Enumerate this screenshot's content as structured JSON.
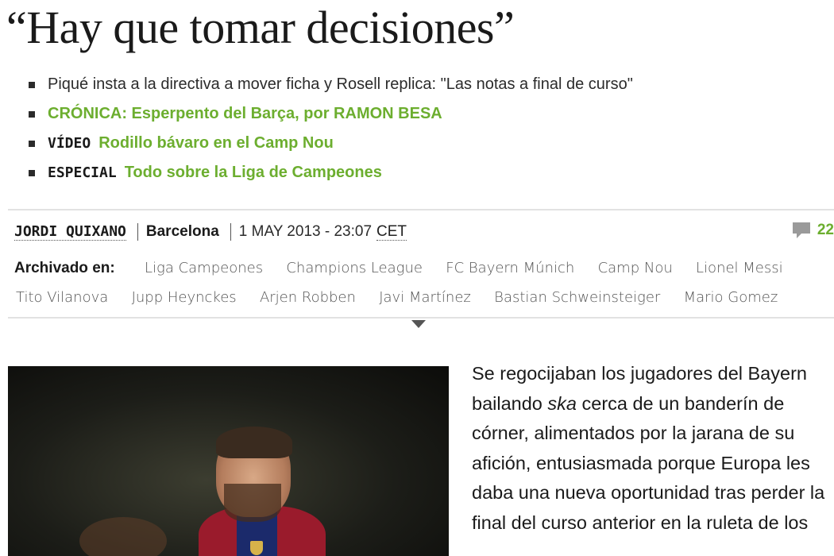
{
  "headline": "“Hay que tomar decisiones”",
  "related": [
    {
      "tag": "",
      "text": "Piqué insta a la directiva a mover ficha y Rosell replica: \"Las notas a final de curso\"",
      "style": "plain"
    },
    {
      "tag": "",
      "text": "CRÓNICA: Esperpento del Barça, por RAMON BESA",
      "style": "green"
    },
    {
      "tag": "VÍDEO",
      "text": "Rodillo bávaro en el Camp Nou",
      "style": "green"
    },
    {
      "tag": "ESPECIAL",
      "text": "Todo sobre la Liga de Campeones",
      "style": "green"
    }
  ],
  "byline": {
    "author": "JORDI QUIXANO",
    "place": "Barcelona",
    "date": "1 MAY 2013 - 23:07",
    "timezone": "CET",
    "comments_count": "22"
  },
  "tags": {
    "label": "Archivado en:",
    "row1": [
      "Liga Campeones",
      "Champions League",
      "FC Bayern Múnich",
      "Camp Nou",
      "Lionel Messi"
    ],
    "row2": [
      "Tito Vilanova",
      "Jupp Heynckes",
      "Arjen Robben",
      "Javi Martínez",
      "Bastian Schweinsteiger",
      "Mario Gomez"
    ]
  },
  "article": {
    "p1_before": "Se regocijaban los jugadores del Bayern bailando ",
    "p1_em": "ska",
    "p1_after": " cerca de un banderín de córner, alimentados por la jarana de su afición, entusiasmada porque Europa les daba una nueva oportunidad tras perder la final del curso anterior en la ruleta de los"
  },
  "colors": {
    "accent_green": "#6cae2f",
    "text_dark": "#1a1a1a",
    "divider": "#e2e2e2"
  },
  "icons": {
    "comments": "speech-bubble-icon",
    "bullet": "square-bullet-icon",
    "expand": "triangle-down-icon"
  }
}
